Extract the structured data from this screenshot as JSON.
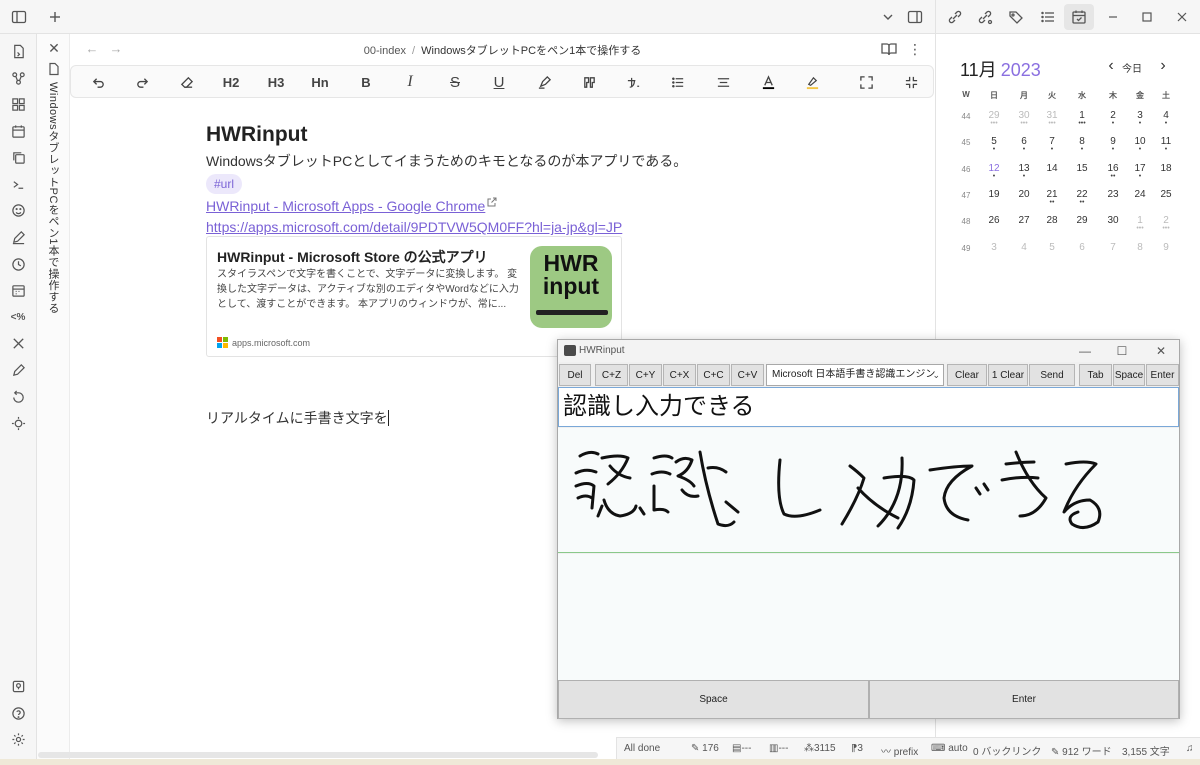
{
  "note": {
    "breadcrumb_folder": "00-index",
    "breadcrumb_sep": "/",
    "breadcrumb_file": "WindowsタブレットPCをペン1本で操作する",
    "tab_title": "WindowsタブレットPCをペン1本で操作する",
    "title": "HWRinput",
    "description": "WindowsタブレットPCとしてイまうためのキモとなるのが本アプリである。",
    "tag": "#url",
    "link_title": "HWRinput - Microsoft Apps - Google Chrome",
    "link_url": "https://apps.microsoft.com/detail/9PDTVW5QM0FF?hl=ja-jp&gl=JP",
    "card_title": "HWRinput - Microsoft Store の公式アプリ",
    "card_desc": "スタイラスペンで文字を書くことで、文字データに変換します。 変換した文字データは、アクティブな別のエディタやWordなどに入力として、渡すことができます。 本アプリのウィンドウが、常に...",
    "card_logo_line1": "HWR",
    "card_logo_line2": "input",
    "card_domain": "apps.microsoft.com",
    "typing_text": "リアルタイムに手書き文字を"
  },
  "toolbar": {
    "h2": "H2",
    "h3": "H3",
    "hn": "Hn",
    "bold": "B",
    "italic": "I",
    "strike": "S",
    "underline": "U"
  },
  "calendar": {
    "month": "11月",
    "year": "2023",
    "today_label": "今日",
    "weekday_headers": [
      "W",
      "日",
      "月",
      "火",
      "水",
      "木",
      "金",
      "土"
    ],
    "weeks": [
      {
        "w": "44",
        "days": [
          "29",
          "30",
          "31",
          "1",
          "2",
          "3",
          "4"
        ]
      },
      {
        "w": "45",
        "days": [
          "5",
          "6",
          "7",
          "8",
          "9",
          "10",
          "11"
        ]
      },
      {
        "w": "46",
        "days": [
          "12",
          "13",
          "14",
          "15",
          "16",
          "17",
          "18"
        ]
      },
      {
        "w": "47",
        "days": [
          "19",
          "20",
          "21",
          "22",
          "23",
          "24",
          "25"
        ]
      },
      {
        "w": "48",
        "days": [
          "26",
          "27",
          "28",
          "29",
          "30",
          "1",
          "2"
        ]
      },
      {
        "w": "49",
        "days": [
          "3",
          "4",
          "5",
          "6",
          "7",
          "8",
          "9"
        ]
      }
    ],
    "accent_color": "#8a6fe0"
  },
  "hwr": {
    "window_title": "HWRinput",
    "buttons": [
      "Del",
      "C+Z",
      "C+Y",
      "C+X",
      "C+C",
      "C+V"
    ],
    "engine": "Microsoft 日本語手書き認識エンジン",
    "clear": "Clear",
    "one_clear": "1 Clear",
    "send": "Send",
    "tab": "Tab",
    "space_small": "Space",
    "enter_small": "Enter",
    "result_text": "認識し入力できる",
    "space_big": "Space",
    "enter_big": "Enter"
  },
  "status": {
    "sync": "All done",
    "s1": "176",
    "s2": "---",
    "s3": "---",
    "s4": "3115",
    "s5": "3",
    "s6": "prefix",
    "s7": "auto",
    "backlinks": "0 バックリンク",
    "words": "912 ワード",
    "chars": "3,155 文字"
  }
}
